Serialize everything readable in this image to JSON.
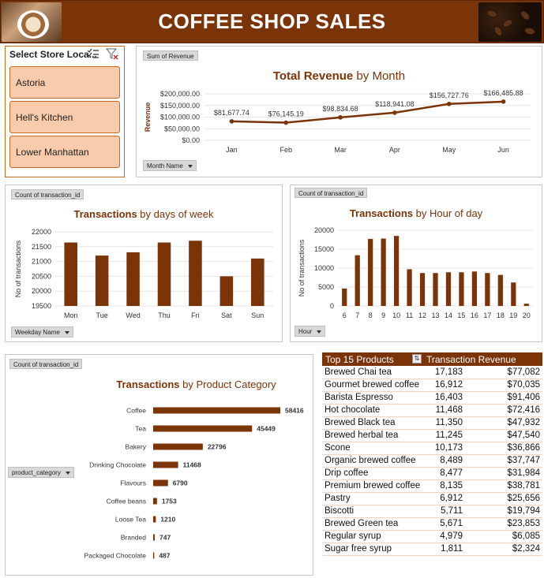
{
  "header": {
    "title": "COFFEE SHOP SALES"
  },
  "slicer": {
    "title": "Select Store Loca...",
    "items": [
      "Astoria",
      "Hell's Kitchen",
      "Lower Manhattan"
    ]
  },
  "revenue_panel": {
    "pill": "Sum of Revenue",
    "title_bold": "Total Revenue",
    "title_rest": " by Month",
    "filter": "Month Name"
  },
  "weekday_panel": {
    "pill": "Count of transaction_id",
    "title_bold": "Transactions",
    "title_rest": " by days of week",
    "filter": "Weekday Name"
  },
  "hour_panel": {
    "pill": "Count of transaction_id",
    "title_bold": "Transactions",
    "title_rest": " by Hour of day",
    "filter": "Hour"
  },
  "category_panel": {
    "pill": "Count of transaction_id",
    "title_bold": "Transactions",
    "title_rest": " by Product Category",
    "filter": "product_category"
  },
  "colors": {
    "brand": "#7b3308",
    "slicer_fill": "#f8cbad",
    "slicer_border": "#c9681f"
  },
  "chart_data": [
    {
      "type": "line",
      "title": "Total Revenue by Month",
      "ylabel": "Revenue",
      "categories": [
        "Jan",
        "Feb",
        "Mar",
        "Apr",
        "May",
        "Jun"
      ],
      "values": [
        81677.74,
        76145.19,
        98834.68,
        118941.08,
        156727.76,
        166485.88
      ],
      "labels": [
        "$81,677.74",
        "$76,145.19",
        "$98,834.68",
        "$118,941.08",
        "$156,727.76",
        "$166,485.88"
      ],
      "yticks": [
        "$0.00",
        "$50,000.00",
        "$100,000.00",
        "$150,000.00",
        "$200,000.00"
      ],
      "ylim": [
        0,
        200000
      ]
    },
    {
      "type": "bar",
      "title": "Transactions by days of week",
      "ylabel": "No of transactions",
      "categories": [
        "Mon",
        "Tue",
        "Wed",
        "Thu",
        "Fri",
        "Sat",
        "Sun"
      ],
      "values": [
        21640,
        21200,
        21310,
        21640,
        21700,
        20500,
        21100
      ],
      "yticks": [
        "19500",
        "20000",
        "20500",
        "21000",
        "21500",
        "22000"
      ],
      "ylim": [
        19500,
        22000
      ]
    },
    {
      "type": "bar",
      "title": "Transactions by Hour of day",
      "ylabel": "No of transactions",
      "categories": [
        "6",
        "7",
        "8",
        "9",
        "10",
        "11",
        "12",
        "13",
        "14",
        "15",
        "16",
        "17",
        "18",
        "19",
        "20"
      ],
      "values": [
        4600,
        13400,
        17700,
        17800,
        18500,
        9700,
        8700,
        8700,
        8900,
        8900,
        9100,
        8700,
        8200,
        6200,
        600
      ],
      "yticks": [
        "0",
        "5000",
        "10000",
        "15000",
        "20000"
      ],
      "ylim": [
        0,
        20000
      ]
    },
    {
      "type": "bar",
      "orientation": "horizontal",
      "title": "Transactions by Product Category",
      "categories": [
        "Coffee",
        "Tea",
        "Bakery",
        "Drinking Chocolate",
        "Flavours",
        "Coffee beans",
        "Loose Tea",
        "Branded",
        "Packaged Chocolate"
      ],
      "values": [
        58416,
        45449,
        22796,
        11468,
        6790,
        1753,
        1210,
        747,
        487
      ]
    },
    {
      "type": "table",
      "columns": [
        "Top 15 Products",
        "Transaction Revenue"
      ],
      "rows": [
        [
          "Brewed Chai tea",
          "17,183",
          "$77,082"
        ],
        [
          "Gourmet brewed coffee",
          "16,912",
          "$70,035"
        ],
        [
          "Barista Espresso",
          "16,403",
          "$91,406"
        ],
        [
          "Hot chocolate",
          "11,468",
          "$72,416"
        ],
        [
          "Brewed Black tea",
          "11,350",
          "$47,932"
        ],
        [
          "Brewed herbal tea",
          "11,245",
          "$47,540"
        ],
        [
          "Scone",
          "10,173",
          "$36,866"
        ],
        [
          "Organic brewed coffee",
          "8,489",
          "$37,747"
        ],
        [
          "Drip coffee",
          "8,477",
          "$31,984"
        ],
        [
          "Premium brewed coffee",
          "8,135",
          "$38,781"
        ],
        [
          "Pastry",
          "6,912",
          "$25,656"
        ],
        [
          "Biscotti",
          "5,711",
          "$19,794"
        ],
        [
          "Brewed Green tea",
          "5,671",
          "$23,853"
        ],
        [
          "Regular syrup",
          "4,979",
          "$6,085"
        ],
        [
          "Sugar free syrup",
          "1,811",
          "$2,324"
        ]
      ]
    }
  ]
}
